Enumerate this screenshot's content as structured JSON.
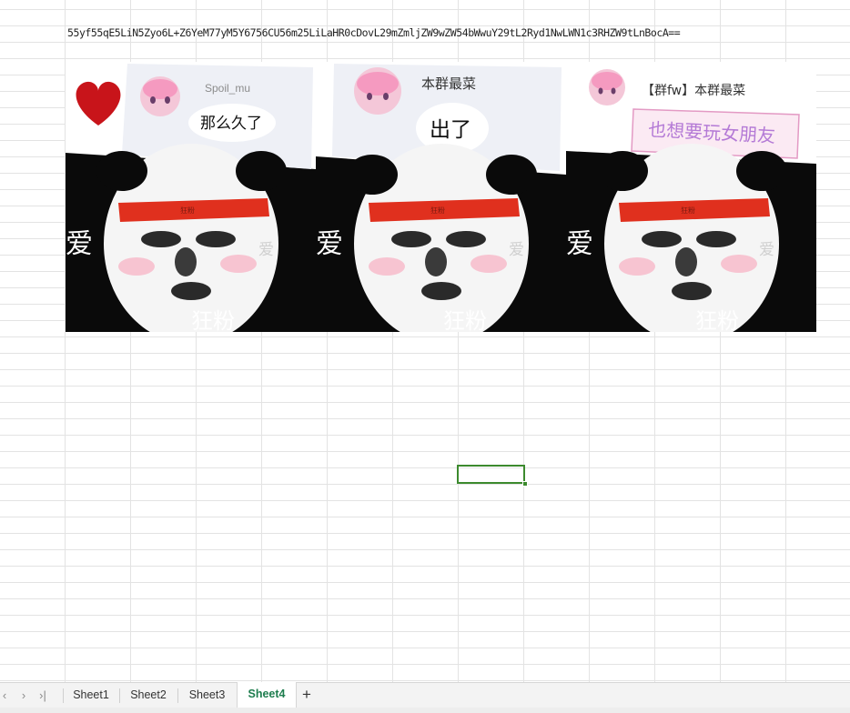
{
  "cell_a1_text": "55yf55qE5LiN5Zyo6L+Z6YeM77yM5Y6756CU56m25LiLaHR0cDovL29mZmljZW9wZW54bWwuY29tL2Ryd1NwLWN1c3RHZW9tLnBocA==",
  "meme": {
    "panels": [
      {
        "username": "Spoil_mu",
        "bubble_text": "那么久了",
        "watermark_left": "爱",
        "watermark_right": "爱",
        "caption": "狂粉",
        "headband_text": "狂粉"
      },
      {
        "username": "本群最菜",
        "bubble_text": "出了",
        "watermark_left": "爱",
        "watermark_right": "爱",
        "caption": "狂粉",
        "headband_text": "狂粉"
      },
      {
        "username": "【群fw】本群最菜",
        "bubble_text": "也想要玩女朋友",
        "watermark_left": "爱",
        "watermark_right": "爱",
        "caption": "狂粉",
        "headband_text": "狂粉"
      }
    ]
  },
  "sheet_nav": {
    "first": "‹",
    "prev": "›",
    "last": "›|"
  },
  "tabs": [
    {
      "label": "Sheet1",
      "active": false
    },
    {
      "label": "Sheet2",
      "active": false
    },
    {
      "label": "Sheet3",
      "active": false
    },
    {
      "label": "Sheet4",
      "active": true
    }
  ],
  "add_sheet_label": "+",
  "colors": {
    "selection": "#3c8a2e",
    "active_tab_text": "#1e7d4e",
    "headband": "#e0301e",
    "bubble_accent": "#b47ad6"
  }
}
